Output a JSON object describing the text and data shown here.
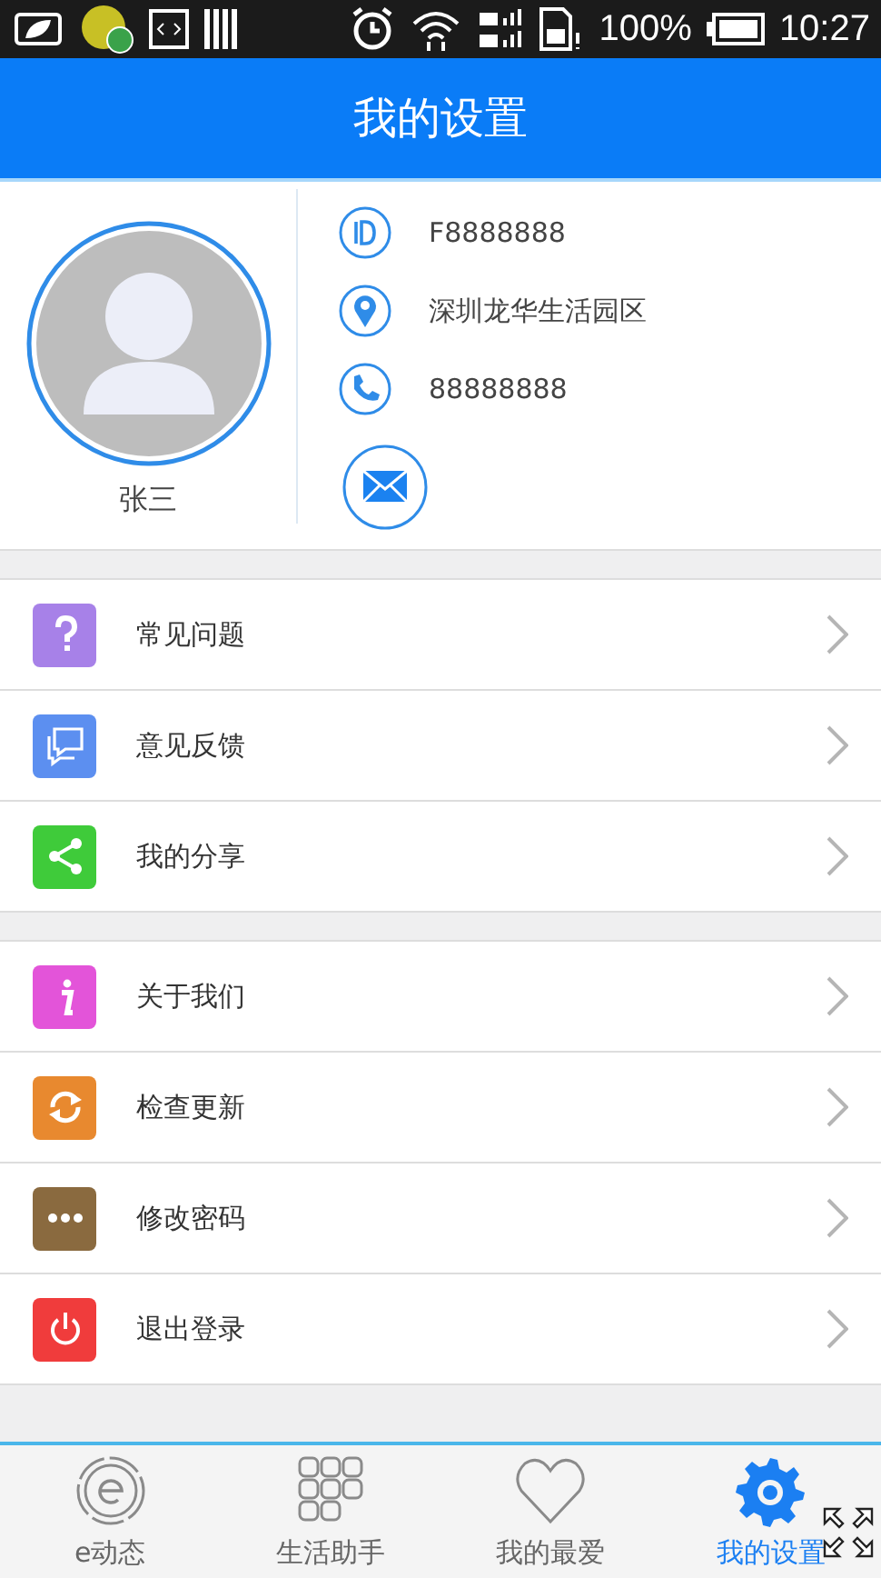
{
  "status_bar": {
    "battery": "100%",
    "time": "10:27"
  },
  "header": {
    "title": "我的设置"
  },
  "profile": {
    "name": "张三",
    "details": [
      {
        "kind": "id",
        "text": "F8888888"
      },
      {
        "kind": "location",
        "text": "深圳龙华生活园区"
      },
      {
        "kind": "phone",
        "text": "88888888"
      },
      {
        "kind": "mail"
      }
    ]
  },
  "menu_groups": [
    {
      "items": [
        {
          "kind": "faq",
          "label": "常见问题",
          "color": "#a781e8"
        },
        {
          "kind": "feedback",
          "label": "意见反馈",
          "color": "#5c8ff0"
        },
        {
          "kind": "share",
          "label": "我的分享",
          "color": "#3fcb3a"
        }
      ]
    },
    {
      "items": [
        {
          "kind": "about",
          "label": "关于我们",
          "color": "#e354d9"
        },
        {
          "kind": "update",
          "label": "检查更新",
          "color": "#e8892f"
        },
        {
          "kind": "password",
          "label": "修改密码",
          "color": "#8a6a3f"
        },
        {
          "kind": "logout",
          "label": "退出登录",
          "color": "#f03c3c"
        }
      ]
    }
  ],
  "tabs": [
    {
      "kind": "news",
      "label": "e动态",
      "selected": false
    },
    {
      "kind": "apps",
      "label": "生活助手",
      "selected": false
    },
    {
      "kind": "favorites",
      "label": "我的最爱",
      "selected": false
    },
    {
      "kind": "settings",
      "label": "我的设置",
      "selected": true
    }
  ]
}
